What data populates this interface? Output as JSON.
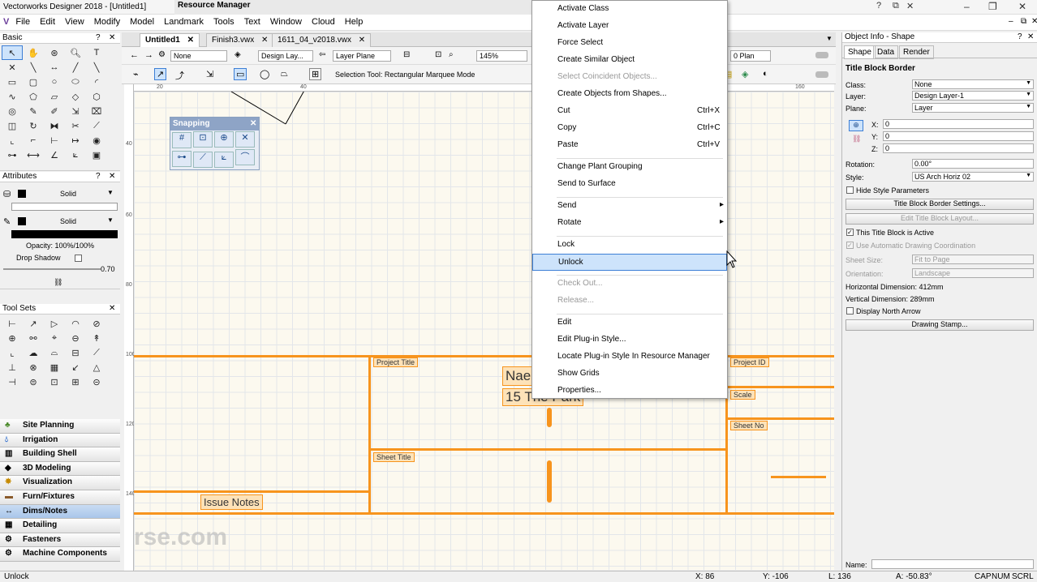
{
  "app": {
    "title": "Vectorworks Designer 2018 - [Untitled1]",
    "resource_manager_title": "Resource Manager"
  },
  "menu": [
    "File",
    "Edit",
    "View",
    "Modify",
    "Model",
    "Landmark",
    "Tools",
    "Text",
    "Window",
    "Cloud",
    "Help"
  ],
  "palettes": {
    "basic": "Basic",
    "attributes": "Attributes",
    "tool_sets": "Tool Sets",
    "fill_style": "Solid",
    "pen_style": "Solid",
    "opacity": "Opacity: 100%/100%",
    "drop_shadow": "Drop Shadow",
    "line_weight": "0.70"
  },
  "toolsets": [
    {
      "label": "Site Planning"
    },
    {
      "label": "Irrigation"
    },
    {
      "label": "Building Shell"
    },
    {
      "label": "3D Modeling"
    },
    {
      "label": "Visualization"
    },
    {
      "label": "Furn/Fixtures"
    },
    {
      "label": "Dims/Notes"
    },
    {
      "label": "Detailing"
    },
    {
      "label": "Fasteners"
    },
    {
      "label": "Machine Components"
    }
  ],
  "tabs": [
    {
      "label": "Untitled1",
      "active": true
    },
    {
      "label": "Finish3.vwx",
      "active": false
    },
    {
      "label": "1611_04_v2018.vwx",
      "active": false
    }
  ],
  "viewbar": {
    "class_sel": "None",
    "layer_sel": "Design Lay...",
    "plane_sel": "Layer Plane",
    "zoom": "145%",
    "view": "0 Plan"
  },
  "mode_hint": "Selection Tool: Rectangular Marquee Mode",
  "snapping": {
    "title": "Snapping"
  },
  "drawing": {
    "project_title": "Project Title",
    "sheet_title": "Sheet Title",
    "issue_notes": "Issue Notes",
    "name_text": "Nae",
    "address_text": "15 The Park",
    "project_id": "Project ID",
    "scale": "Scale",
    "sheet_no": "Sheet No"
  },
  "rulers": {
    "top": [
      "20",
      "40",
      "160"
    ],
    "left": [
      "40",
      "60",
      "80",
      "100",
      "120",
      "140"
    ]
  },
  "context_menu": [
    {
      "label": "Activate Class"
    },
    {
      "label": "Activate Layer"
    },
    {
      "label": "Force Select"
    },
    {
      "label": "Create Similar Object"
    },
    {
      "label": "Select Coincident Objects...",
      "disabled": true
    },
    {
      "label": "Create Objects from Shapes..."
    },
    {
      "label": "Cut",
      "shortcut": "Ctrl+X"
    },
    {
      "label": "Copy",
      "shortcut": "Ctrl+C"
    },
    {
      "label": "Paste",
      "shortcut": "Ctrl+V"
    },
    {
      "sep": true
    },
    {
      "label": "Change Plant Grouping"
    },
    {
      "label": "Send to Surface"
    },
    {
      "sep": true
    },
    {
      "label": "Send",
      "submenu": true
    },
    {
      "label": "Rotate",
      "submenu": true
    },
    {
      "sep": true
    },
    {
      "label": "Lock"
    },
    {
      "label": "Unlock",
      "highlighted": true
    },
    {
      "sep": true
    },
    {
      "label": "Check Out...",
      "disabled": true
    },
    {
      "label": "Release...",
      "disabled": true
    },
    {
      "sep": true
    },
    {
      "label": "Edit"
    },
    {
      "label": "Edit Plug-in Style..."
    },
    {
      "label": "Locate Plug-in Style In Resource Manager"
    },
    {
      "label": "Show Grids"
    },
    {
      "label": "Properties..."
    }
  ],
  "object_info": {
    "header": "Object Info - Shape",
    "tabs": [
      "Shape",
      "Data",
      "Render"
    ],
    "object_type": "Title Block Border",
    "class_label": "Class:",
    "class_value": "None",
    "layer_label": "Layer:",
    "layer_value": "Design Layer-1",
    "plane_label": "Plane:",
    "plane_value": "Layer",
    "x_label": "X:",
    "x_value": "0",
    "y_label": "Y:",
    "y_value": "0",
    "z_label": "Z:",
    "z_value": "0",
    "rotation_label": "Rotation:",
    "rotation_value": "0.00°",
    "style_label": "Style:",
    "style_value": "US Arch Horiz 02",
    "hide_style": "Hide Style Parameters",
    "border_settings": "Title Block Border Settings...",
    "edit_layout": "Edit Title Block Layout...",
    "active": "This Title Block is Active",
    "auto_coord": "Use Automatic Drawing Coordination",
    "sheet_size_label": "Sheet Size:",
    "sheet_size_value": "Fit to Page",
    "orientation_label": "Orientation:",
    "orientation_value": "Landscape",
    "h_dim": "Horizontal Dimension: 412mm",
    "v_dim": "Vertical Dimension: 289mm",
    "north_arrow": "Display North Arrow",
    "drawing_stamp": "Drawing Stamp...",
    "name_label": "Name:"
  },
  "status": {
    "left": "Unlock",
    "x": "X: 86",
    "y": "Y: -106",
    "l": "L: 136",
    "a": "A: -50.83°",
    "caps": "CAP",
    "num": "NUM",
    "scrl": "SCRL"
  },
  "watermark": "filehorse.com"
}
